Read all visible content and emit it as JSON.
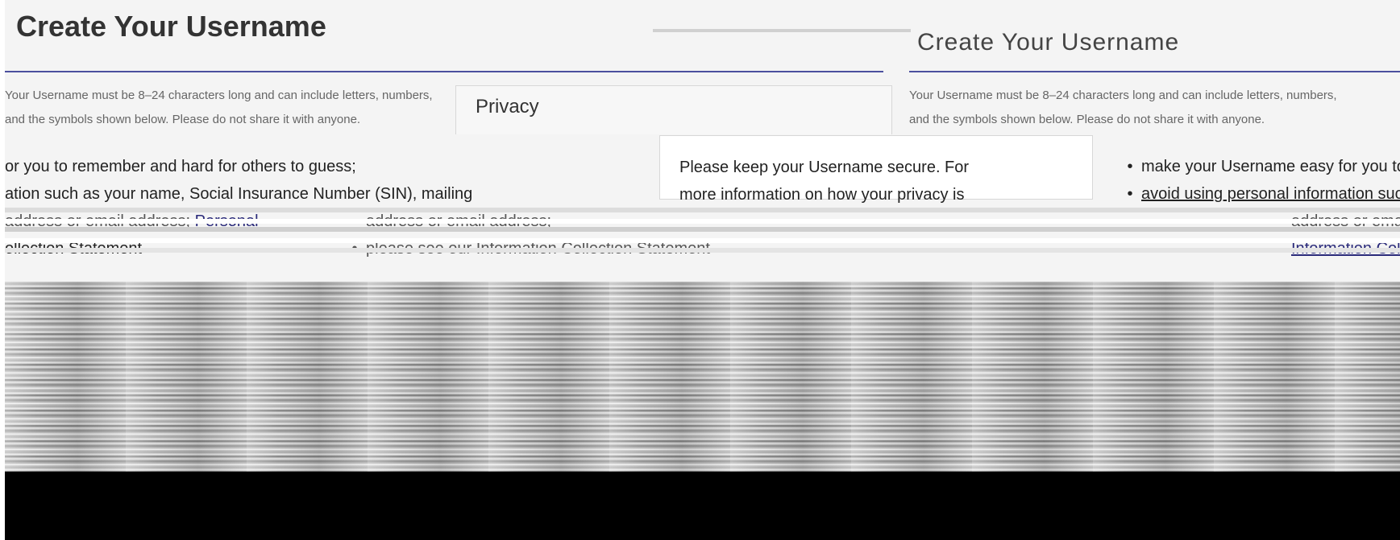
{
  "page": {
    "heading_left": "Create Your Username",
    "heading_right": "Create Your Username",
    "intro_left_line1": "Your Username must be 8–24 characters long and can include letters, numbers,",
    "intro_left_line2": "and the symbols shown below. Please do not share it with anyone.",
    "intro_right_line1": "Your Username must be 8–24 characters long and can include letters, numbers,",
    "intro_right_line2": "and the symbols shown below. Please do not share it with anyone."
  },
  "privacy": {
    "title": "Privacy",
    "body_line1": "Please keep your Username secure. For",
    "body_line2": "more information on how your privacy is"
  },
  "guidelines_left": {
    "line1": "or you to remember and hard for others to guess;",
    "line2": "ation such as your name, Social Insurance Number (SIN), mailing",
    "line3_prefix": "address or email address; ",
    "line3_link": "Personal",
    "line4": "ollection Statement"
  },
  "guidelines_right": {
    "bullet1": "make your Username easy for you to remember and hard for others to guess;",
    "bullet2": "avoid using personal information such as your name, Social Insurance Number (SIN), mailing",
    "line3": "address or email address;",
    "line4_link": "Information Collection Statement"
  },
  "middle_lines": {
    "line1": "address or email address;",
    "bullet": "please see our Information Collection Statement"
  },
  "colors": {
    "accent_rule": "#4b4f9e",
    "link": "#2a2a7a",
    "panel_bg": "#f7f7f7",
    "panel_border": "#d7d7d7"
  }
}
